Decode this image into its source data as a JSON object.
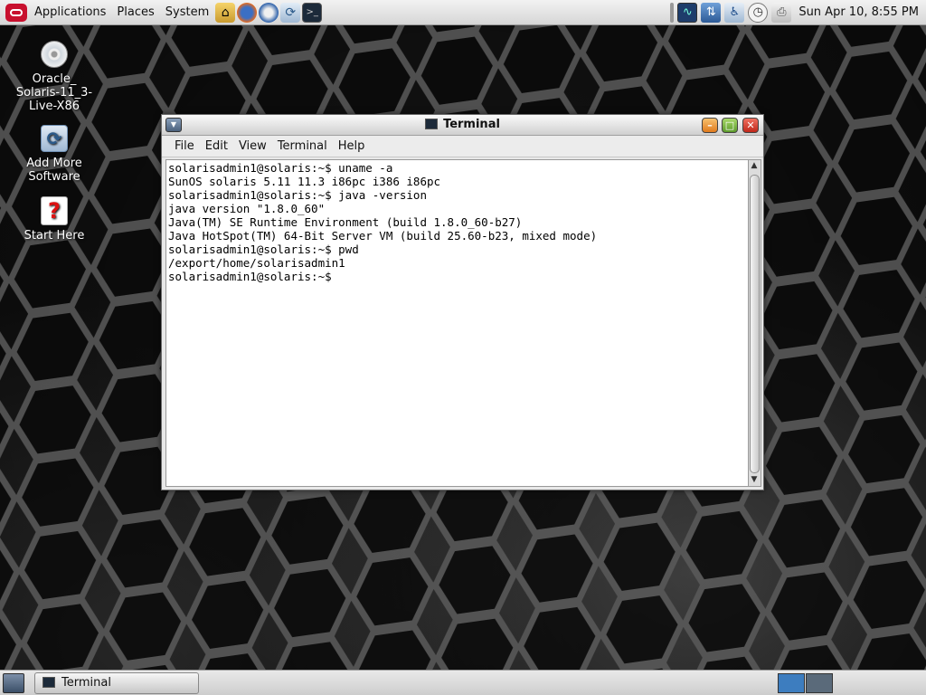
{
  "top_panel": {
    "menus": [
      "Applications",
      "Places",
      "System"
    ],
    "clock": "Sun Apr 10,  8:55 PM"
  },
  "desktop_icons": [
    {
      "label": "Oracle_\nSolaris-11_3-\nLive-X86",
      "icon": "cd-icon"
    },
    {
      "label": "Add More\nSoftware",
      "icon": "package-icon"
    },
    {
      "label": "Start Here",
      "icon": "help-icon"
    }
  ],
  "terminal": {
    "title": "Terminal",
    "menu": [
      "File",
      "Edit",
      "View",
      "Terminal",
      "Help"
    ],
    "lines": [
      "solarisadmin1@solaris:~$ uname -a",
      "SunOS solaris 5.11 11.3 i86pc i386 i86pc",
      "solarisadmin1@solaris:~$ java -version",
      "java version \"1.8.0_60\"",
      "Java(TM) SE Runtime Environment (build 1.8.0_60-b27)",
      "Java HotSpot(TM) 64-Bit Server VM (build 25.60-b23, mixed mode)",
      "solarisadmin1@solaris:~$ pwd",
      "/export/home/solarisadmin1",
      "solarisadmin1@solaris:~$"
    ]
  },
  "bottom_panel": {
    "task_label": "Terminal"
  },
  "colors": {
    "oracle_red": "#c8102e",
    "panel": "#dcdcdc",
    "close": "#c0281a",
    "minimize": "#e07b1e",
    "maximize": "#5b9a2a"
  }
}
